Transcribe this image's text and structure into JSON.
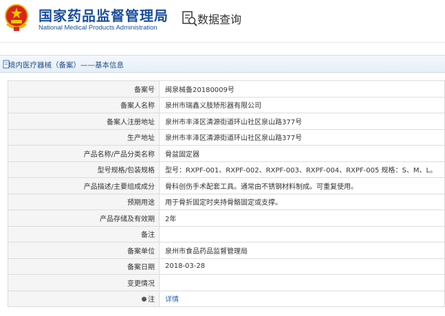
{
  "header": {
    "title_cn": "国家药品监督管理局",
    "title_en": "National Medical Products Administration",
    "query_label": "数据查询"
  },
  "breadcrumb": "境内医疗器械（备案）——基本信息",
  "rows": [
    {
      "label": "备案号",
      "value": "闽泉械备20180009号"
    },
    {
      "label": "备案人名称",
      "value": "泉州市瑞鑫义肢矫形器有限公司"
    },
    {
      "label": "备案人注册地址",
      "value": "泉州市丰泽区清源街道环山社区泉山路377号"
    },
    {
      "label": "生产地址",
      "value": "泉州市丰泽区清源街道环山社区泉山路377号"
    },
    {
      "label": "产品名称/产品分类名称",
      "value": "骨盆固定器"
    },
    {
      "label": "型号规格/包装规格",
      "value": "型号：RXPF-001、RXPF-002、RXPF-003、RXPF-004、RXPF-005 规格：S、M、L。"
    },
    {
      "label": "产品描述/主要组成成分",
      "value": "骨科创伤手术配套工具。通常由不锈钢材料制成。可重复使用。"
    },
    {
      "label": "预期用途",
      "value": "用于骨折固定时夹持骨骼固定或支撑。"
    },
    {
      "label": "产品存储及有效期",
      "value": "2年"
    },
    {
      "label": "备注",
      "value": ""
    },
    {
      "label": "备案单位",
      "value": "泉州市食品药品监督管理局"
    },
    {
      "label": "备案日期",
      "value": "2018-03-28"
    },
    {
      "label": "变更情况",
      "value": ""
    },
    {
      "label": "注",
      "value": "详情"
    }
  ],
  "colors": {
    "brand_blue": "#1a4e9e",
    "link_blue": "#2a63b5"
  },
  "icons": [
    "national-emblem-icon",
    "data-query-icon",
    "document-icon",
    "note-icon"
  ]
}
